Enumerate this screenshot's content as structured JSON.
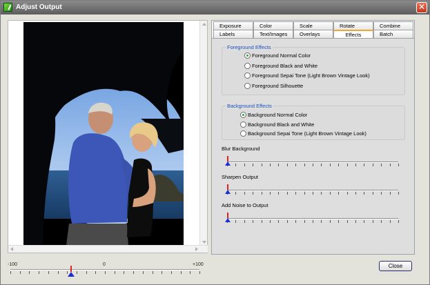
{
  "window": {
    "title": "Adjust Output"
  },
  "image_photo": "photo",
  "zoom": {
    "min_label": "-100",
    "mid_label": "0",
    "max_label": "+100",
    "value_fraction": 0.32
  },
  "tabs": {
    "row1": [
      "Exposure",
      "Color",
      "Scale",
      "Rotate",
      "Combine"
    ],
    "row2": [
      "Labels",
      "Text/Images",
      "Overlays",
      "Effects",
      "Batch"
    ],
    "active": "Effects"
  },
  "foreground": {
    "title": "Foreground Effects",
    "options": [
      {
        "label": "Foreground  Normal Color",
        "checked": true
      },
      {
        "label": "Foreground  Black and White",
        "checked": false
      },
      {
        "label": "Foreground  Sepai Tone (Light Brown Vintage Look)",
        "checked": false
      },
      {
        "label": "Foreground  Silhouette",
        "checked": false
      }
    ]
  },
  "background": {
    "title": "Background Effects",
    "options": [
      {
        "label": "Background  Normal Color",
        "checked": true
      },
      {
        "label": "Background  Black and White",
        "checked": false
      },
      {
        "label": "Background  Sepai Tone (Light Brown Vintage Look)",
        "checked": false
      }
    ]
  },
  "sliders": [
    {
      "label": "Blur Background",
      "value_fraction": 0.0
    },
    {
      "label": "Sharpen Output",
      "value_fraction": 0.0
    },
    {
      "label": "Add Noise to Output",
      "value_fraction": 0.0
    }
  ],
  "close_label": "Close",
  "colors": {
    "accent_tab": "#f2a435",
    "group_title": "#1f4fbf",
    "thumb": "#1a2fd1"
  }
}
